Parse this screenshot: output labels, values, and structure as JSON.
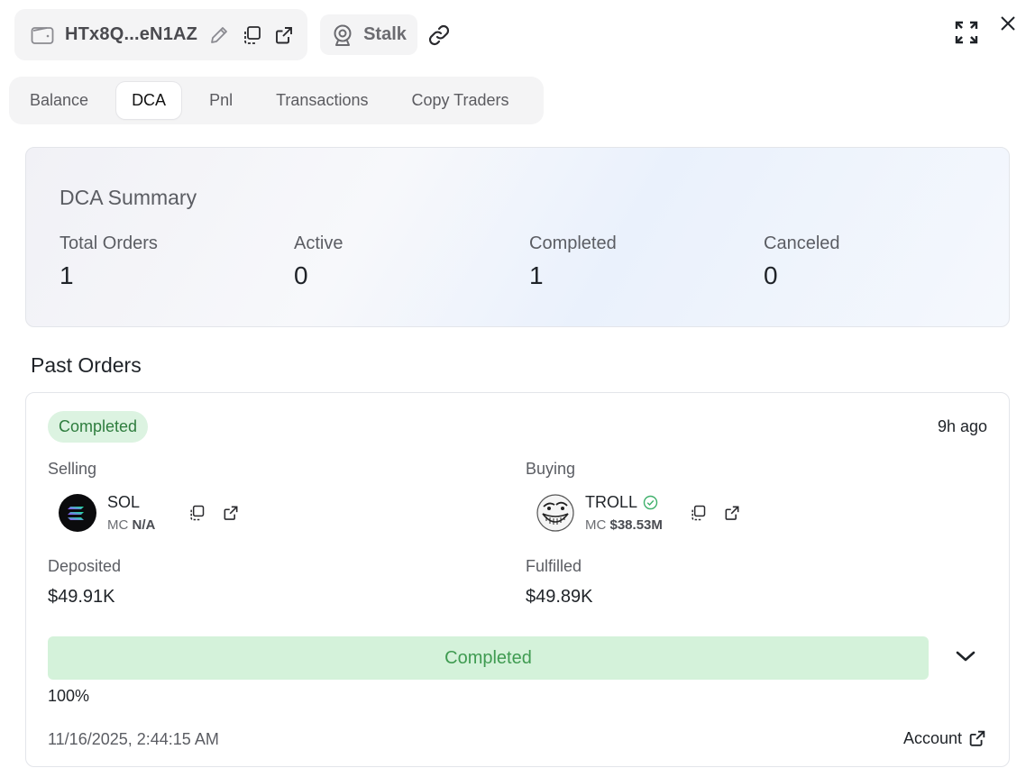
{
  "header": {
    "wallet_address": "HTx8Q...eN1AZ",
    "stalk_label": "Stalk"
  },
  "tabs": [
    {
      "label": "Balance",
      "active": false
    },
    {
      "label": "DCA",
      "active": true
    },
    {
      "label": "Pnl",
      "active": false
    },
    {
      "label": "Transactions",
      "active": false
    },
    {
      "label": "Copy Traders",
      "active": false
    }
  ],
  "summary": {
    "title": "DCA Summary",
    "stats": [
      {
        "label": "Total Orders",
        "value": "1"
      },
      {
        "label": "Active",
        "value": "0"
      },
      {
        "label": "Completed",
        "value": "1"
      },
      {
        "label": "Canceled",
        "value": "0"
      }
    ]
  },
  "past_orders": {
    "title": "Past Orders",
    "orders": [
      {
        "status": "Completed",
        "time_ago": "9h ago",
        "selling": {
          "label": "Selling",
          "symbol": "SOL",
          "mc_label": "MC",
          "mc_value": "N/A",
          "icon": "solana-logo"
        },
        "buying": {
          "label": "Buying",
          "symbol": "TROLL",
          "mc_label": "MC",
          "mc_value": "$38.53M",
          "icon": "troll-face-logo",
          "verified": true
        },
        "deposited": {
          "label": "Deposited",
          "value": "$49.91K"
        },
        "fulfilled": {
          "label": "Fulfilled",
          "value": "$49.89K"
        },
        "progress": {
          "label": "Completed",
          "percent_text": "100%",
          "fraction": 1.0
        },
        "timestamp": "11/16/2025, 2:44:15 AM",
        "account_link": "Account"
      }
    ]
  },
  "colors": {
    "badge_bg": "#dcf3e1",
    "badge_text": "#2e7d3e",
    "progress_fill": "#d4f2da",
    "progress_text": "#3f9b51",
    "verified": "#3fb06b"
  }
}
